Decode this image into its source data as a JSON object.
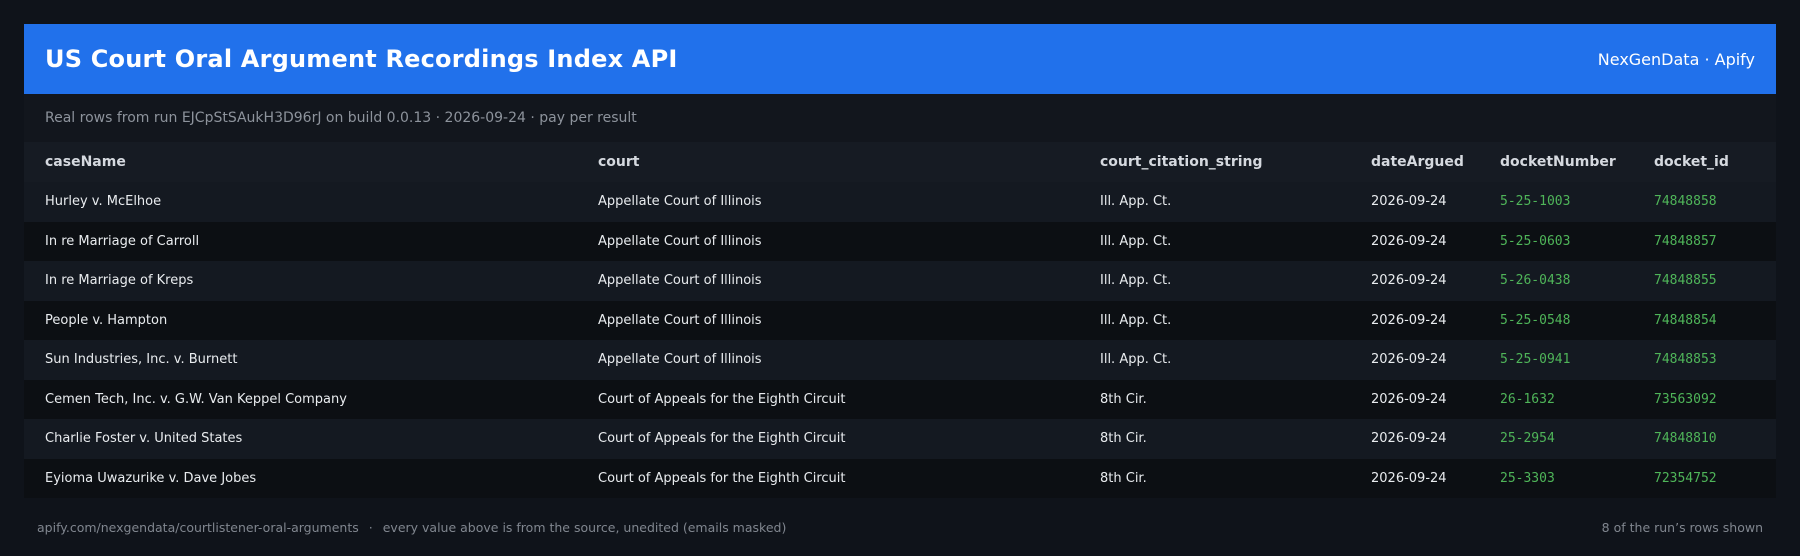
{
  "header": {
    "title": "US Court Oral Argument Recordings Index API",
    "brand": "NexGenData · Apify"
  },
  "subtitle": "Real rows from run EJCpStSAukH3D96rJ on build 0.0.13 · 2026-09-24 · pay per result",
  "table": {
    "columns": [
      "caseName",
      "court",
      "court_citation_string",
      "dateArgued",
      "docketNumber",
      "docket_id"
    ],
    "rows": [
      [
        "Hurley v. McElhoe",
        "Appellate Court of Illinois",
        "Ill. App. Ct.",
        "2026-09-24",
        "5-25-1003",
        "74848858"
      ],
      [
        "In re Marriage of Carroll",
        "Appellate Court of Illinois",
        "Ill. App. Ct.",
        "2026-09-24",
        "5-25-0603",
        "74848857"
      ],
      [
        "In re Marriage of Kreps",
        "Appellate Court of Illinois",
        "Ill. App. Ct.",
        "2026-09-24",
        "5-26-0438",
        "74848855"
      ],
      [
        "People v. Hampton",
        "Appellate Court of Illinois",
        "Ill. App. Ct.",
        "2026-09-24",
        "5-25-0548",
        "74848854"
      ],
      [
        "Sun Industries, Inc. v. Burnett",
        "Appellate Court of Illinois",
        "Ill. App. Ct.",
        "2026-09-24",
        "5-25-0941",
        "74848853"
      ],
      [
        "Cemen Tech, Inc. v. G.W. Van Keppel Company",
        "Court of Appeals for the Eighth Circuit",
        "8th Cir.",
        "2026-09-24",
        "26-1632",
        "73563092"
      ],
      [
        "Charlie Foster v. United States",
        "Court of Appeals for the Eighth Circuit",
        "8th Cir.",
        "2026-09-24",
        "25-2954",
        "74848810"
      ],
      [
        "Eyioma Uwazurike v. Dave Jobes",
        "Court of Appeals for the Eighth Circuit",
        "8th Cir.",
        "2026-09-24",
        "25-3303",
        "72354752"
      ]
    ]
  },
  "footer": {
    "url": "apify.com/nexgendata/courtlistener-oral-arguments",
    "separator": "·",
    "note": "every value above is from the source, unedited (emails masked)",
    "count": "8 of the run’s rows shown"
  },
  "colors": {
    "header_bg": "#2171eb",
    "page_bg": "#0f131a",
    "mono_green": "#4fb559"
  }
}
